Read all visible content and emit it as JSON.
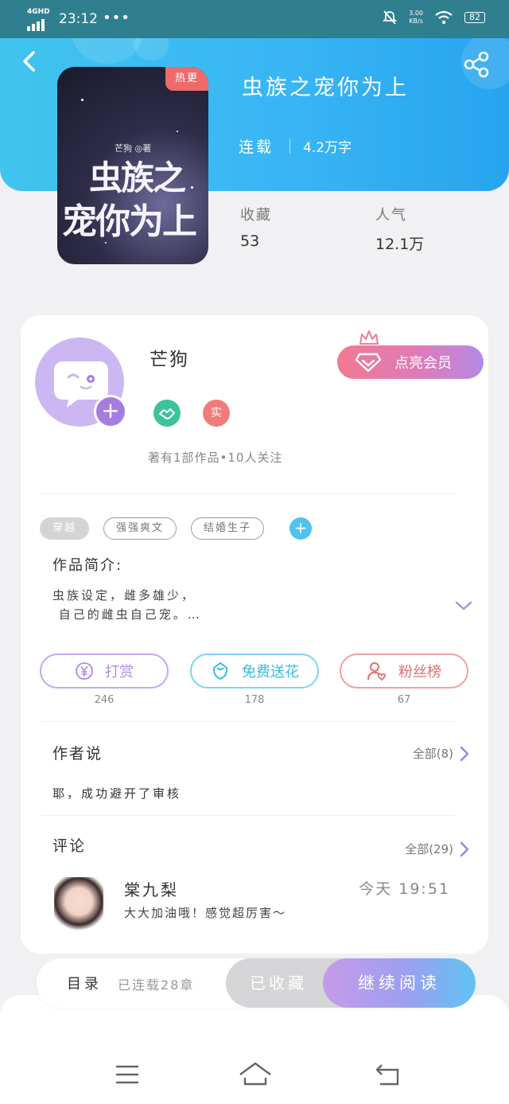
{
  "status_bar": {
    "network": "4GHD",
    "time": "23:12",
    "dots": "•••",
    "speed_value": "3.00",
    "speed_unit": "KB/s",
    "battery": "82"
  },
  "book": {
    "badge": "热更",
    "cover_author": "芒狗 ◎著",
    "cover_title_line1": "虫族之",
    "cover_title_line2": "宠你为上",
    "title": "虫族之宠你为上",
    "status": "连载",
    "words": "4.2万字",
    "stats": [
      {
        "label": "收藏",
        "value": "53"
      },
      {
        "label": "人气",
        "value": "12.1万"
      }
    ]
  },
  "author": {
    "name": "芒狗",
    "badge_real": "实",
    "stats_text": "著有1部作品•10人关注",
    "vip_label": "点亮会员"
  },
  "tags": [
    "穿越",
    "强强爽文",
    "结婚生子"
  ],
  "tag_add": "+",
  "intro": {
    "title": "作品简介:",
    "text": "虫族设定，雌多雄少，\n 自己的雌虫自己宠。…"
  },
  "actions": [
    {
      "label": "打赏",
      "count": "246",
      "color": "#b489e0",
      "icon": "yen-coin-icon"
    },
    {
      "label": "免费送花",
      "count": "178",
      "color": "#4cc6e6",
      "icon": "flower-icon"
    },
    {
      "label": "粉丝榜",
      "count": "67",
      "color": "#ea7b7b",
      "icon": "fan-user-icon"
    }
  ],
  "author_says": {
    "title": "作者说",
    "more": "全部(8)",
    "text": "耶，成功避开了审核"
  },
  "comments": {
    "title": "评论",
    "more": "全部(29)",
    "items": [
      {
        "name": "棠九梨",
        "time": "今天 19:51",
        "text": "大大加油哦！感觉超厉害～"
      }
    ]
  },
  "bottom_bar": {
    "toc": "目录",
    "toc_sub": "已连载28章",
    "collected": "已收藏",
    "read": "继续阅读"
  },
  "colors": {
    "header": "#38b6f4",
    "accent_purple": "#a57de0",
    "vip_gradient_start": "#f07a90",
    "vip_gradient_end": "#b48ae6"
  }
}
